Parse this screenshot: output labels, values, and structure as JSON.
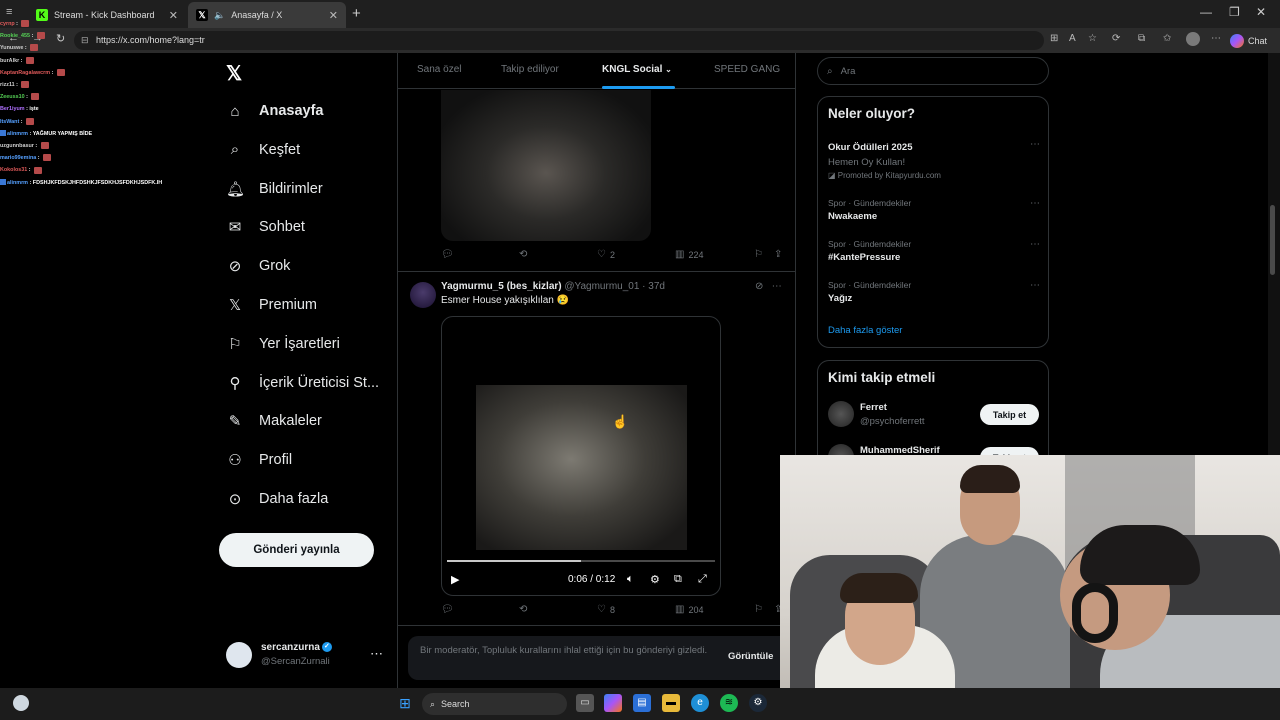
{
  "browser": {
    "tabs": [
      {
        "label": "Stream - Kick Dashboard"
      },
      {
        "label": "Anasayfa / X"
      }
    ],
    "url": "https://x.com/home?lang=tr",
    "chat_button": "Chat"
  },
  "chat_overlay": [
    {
      "user": "cyrnp",
      "msg": ""
    },
    {
      "user": "Rookie_455",
      "msg": ""
    },
    {
      "user": "Yunuswe",
      "msg": ""
    },
    {
      "user": "burAlkr",
      "msg": ""
    },
    {
      "user": "KaptanRagalawcrm",
      "msg": ""
    },
    {
      "user": "rizz11",
      "msg": ""
    },
    {
      "user": "Zeeuss10",
      "msg": ""
    },
    {
      "user": "Ber1iyum",
      "msg": "işte"
    },
    {
      "user": "ItsWant",
      "msg": ""
    },
    {
      "user": "alinmrm",
      "msg": "YAĞMUR YAPMIŞ BİDE"
    },
    {
      "user": "uzgunnbasur",
      "msg": ""
    },
    {
      "user": "mario99emina",
      "msg": ""
    },
    {
      "user": "Kokolos31",
      "msg": ""
    },
    {
      "user": "alinmrm",
      "msg": "FDSHJKFDSKJHFDSHKJFSDKHJSFDKHJSDFK.IH"
    }
  ],
  "x_nav": {
    "items": [
      {
        "label": "Anasayfa",
        "icon": "home-icon"
      },
      {
        "label": "Keşfet",
        "icon": "search-icon"
      },
      {
        "label": "Bildirimler",
        "icon": "bell-icon"
      },
      {
        "label": "Sohbet",
        "icon": "mail-icon"
      },
      {
        "label": "Grok",
        "icon": "grok-icon"
      },
      {
        "label": "Premium",
        "icon": "x-icon"
      },
      {
        "label": "Yer İşaretleri",
        "icon": "bookmark-icon"
      },
      {
        "label": "İçerik Üreticisi St...",
        "icon": "creator-icon"
      },
      {
        "label": "Makaleler",
        "icon": "article-icon"
      },
      {
        "label": "Profil",
        "icon": "person-icon"
      },
      {
        "label": "Daha fazla",
        "icon": "more-circle-icon"
      }
    ],
    "post_button": "Gönderi yayınla",
    "account": {
      "name": "sercanzurna",
      "handle": "@SercanZurnali"
    }
  },
  "feed": {
    "tabs": [
      "Sana özel",
      "Takip ediliyor",
      "KNGL Social",
      "SPEED GANG"
    ],
    "post1": {
      "replies": "",
      "retweets": "",
      "likes": "2",
      "views": "224"
    },
    "post2": {
      "name": "Yagmurmu_5 (bes_kizlar)",
      "handle": "@Yagmurmu_01",
      "time": "37d",
      "text": "Esmer House yakışıklılan 😢",
      "video_time": "0:06 / 0:12",
      "video_progress": 0.5,
      "likes": "8",
      "views": "204"
    },
    "moderation": {
      "text": "Bir moderatör, Topluluk kurallarını ihlal ettiği için bu gönderiyi gizledi.",
      "button": "Görüntüle"
    }
  },
  "sidebar": {
    "search_placeholder": "Ara",
    "trends_title": "Neler oluyor?",
    "promo": {
      "title": "Okur Ödülleri 2025",
      "subtitle": "Hemen Oy Kullan!",
      "by": "Promoted by Kitapyurdu.com"
    },
    "trends": [
      {
        "context": "Spor · Gündemdekiler",
        "name": "Nwakaeme"
      },
      {
        "context": "Spor · Gündemdekiler",
        "name": "#KantePressure"
      },
      {
        "context": "Spor · Gündemdekiler",
        "name": "Yağız"
      }
    ],
    "show_more": "Daha fazla göster",
    "who_to_follow_title": "Kimi takip etmeli",
    "follow": [
      {
        "name": "Ferret",
        "handle": "@psychoferrett",
        "button": "Takip et"
      },
      {
        "name": "MuhammedSherif",
        "handle": "",
        "button": "Takip et"
      }
    ]
  },
  "taskbar": {
    "search": "Search"
  }
}
